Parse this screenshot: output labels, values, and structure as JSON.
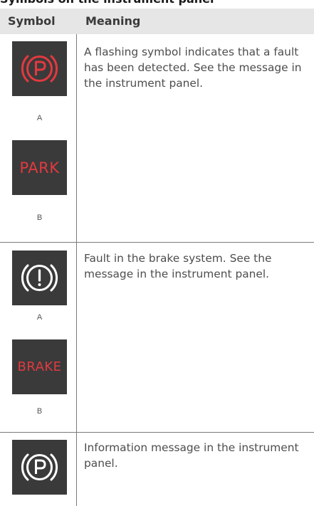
{
  "section_title": "Symbols on the instrument panel",
  "table": {
    "header": {
      "symbol": "Symbol",
      "meaning": "Meaning"
    },
    "rows": [
      {
        "meaning": "A flashing symbol indicates that a fault has been detected. See the message in the instrument panel.",
        "icons": [
          {
            "kind": "parking-brake-red-icon",
            "label": "A"
          },
          {
            "kind": "park-text-icon",
            "text": "PARK",
            "label": "B"
          }
        ]
      },
      {
        "meaning": "Fault in the brake system. See the message in the instrument panel.",
        "icons": [
          {
            "kind": "brake-warning-icon",
            "label": "A"
          },
          {
            "kind": "brake-text-icon",
            "text": "BRAKE",
            "label": "B"
          }
        ]
      },
      {
        "meaning": "Information message in the instrument panel.",
        "icons": [
          {
            "kind": "parking-brake-white-icon"
          }
        ]
      }
    ]
  },
  "colors": {
    "icon_background": "#3a3a3a",
    "warning_red": "#e2393f",
    "info_white": "#ffffff",
    "header_background": "#e6e6e6"
  }
}
